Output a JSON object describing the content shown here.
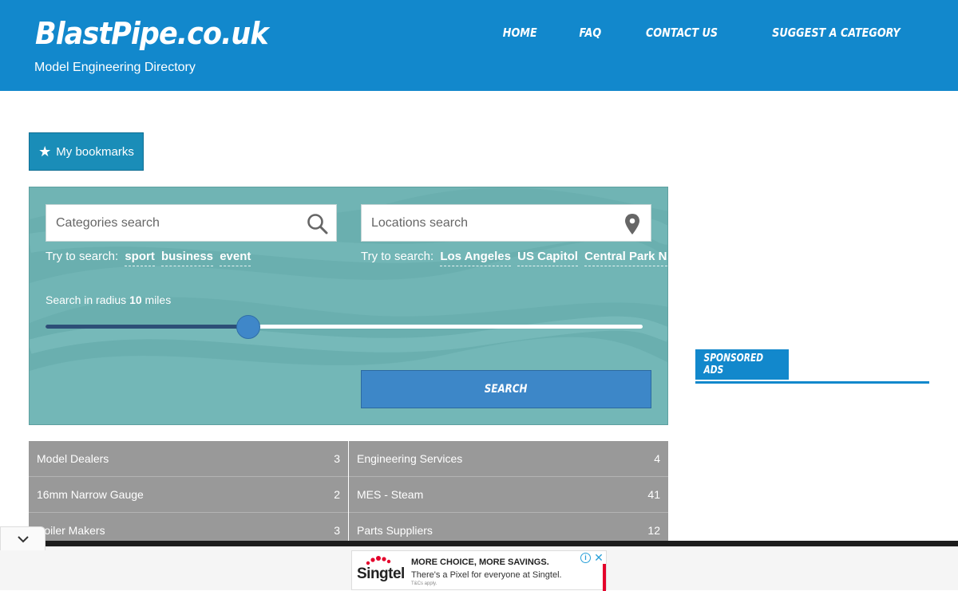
{
  "header": {
    "logo": "BlastPipe.co.uk",
    "tagline": "Model Engineering Directory",
    "nav": [
      {
        "label": "HOME"
      },
      {
        "label": "FAQ"
      },
      {
        "label": "CONTACT US"
      },
      {
        "label": "SUGGEST A CATEGORY"
      }
    ]
  },
  "bookmarks": {
    "label": "My bookmarks",
    "icon": "star-icon"
  },
  "search": {
    "categories_placeholder": "Categories search",
    "locations_placeholder": "Locations search",
    "try_prefix": "Try to search:",
    "category_suggestions": [
      "sport",
      "business",
      "event"
    ],
    "location_suggestions": [
      "Los Angeles",
      "US Capitol",
      "Central Park NY"
    ],
    "radius_prefix": "Search in radius",
    "radius_value": "10",
    "radius_unit": "miles",
    "radius_fraction": 0.34,
    "button_label": "SEARCH"
  },
  "categories_left": [
    {
      "name": "Model Dealers",
      "count": "3"
    },
    {
      "name": "16mm Narrow Gauge",
      "count": "2"
    },
    {
      "name": "Boiler Makers",
      "count": "3"
    }
  ],
  "categories_right": [
    {
      "name": "Engineering Services",
      "count": "4"
    },
    {
      "name": "MES - Steam",
      "count": "41"
    },
    {
      "name": "Parts Suppliers",
      "count": "12"
    }
  ],
  "sponsored": {
    "label": "SPONSORED ADS"
  },
  "ad": {
    "brand": "Singtel",
    "headline": "MORE CHOICE, MORE SAVINGS.",
    "sub": "There's a Pixel for everyone at Singtel.",
    "tc": "T&Cs apply."
  },
  "colors": {
    "header_blue": "#1288cc",
    "panel_teal": "#6aafaf",
    "button_blue": "#3d87c8",
    "category_gray": "#999999",
    "slider_fill": "#2d4f77"
  }
}
